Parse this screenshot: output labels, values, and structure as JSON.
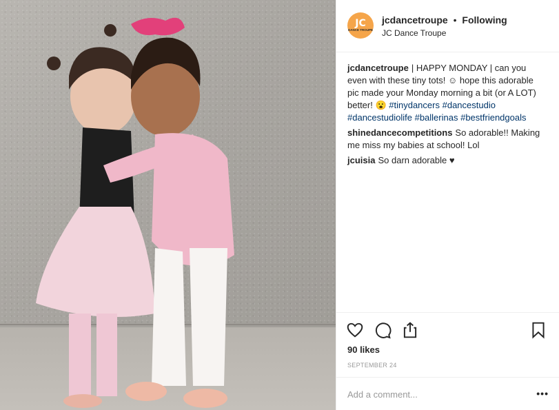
{
  "photo": {
    "description_name": "post-photo"
  },
  "header": {
    "avatar_logo_text": "JC",
    "avatar_logo_subtext": "DANCE TROUPE",
    "username": "jcdancetroupe",
    "separator": "•",
    "follow_status": "Following",
    "full_name": "JC Dance Troupe"
  },
  "caption": {
    "username": "jcdancetroupe",
    "text_before": "| HAPPY MONDAY | can you even with these tiny tots! ☺ hope this adorable pic made your Monday morning a bit (or A LOT) better! 😮 ",
    "hashtags": [
      "#tinydancers",
      "#dancestudio",
      "#dancestudiolife",
      "#ballerinas",
      "#bestfriendgoals"
    ]
  },
  "comments": [
    {
      "username": "shinedancecompetitions",
      "text": "So adorable!! Making me miss my babies at school! Lol"
    },
    {
      "username": "jcuisia",
      "text": "So darn adorable ♥"
    }
  ],
  "actions": {
    "like_icon": "heart-icon",
    "comment_icon": "comment-bubble-icon",
    "share_icon": "share-icon",
    "save_icon": "bookmark-icon"
  },
  "likes_text": "90 likes",
  "date_text": "SEPTEMBER 24",
  "add_comment": {
    "placeholder": "Add a comment...",
    "more_label": "•••"
  },
  "colors": {
    "accent_avatar": "#f5a54a",
    "hashtag": "#003569",
    "muted": "#999999",
    "border": "#efefef"
  }
}
